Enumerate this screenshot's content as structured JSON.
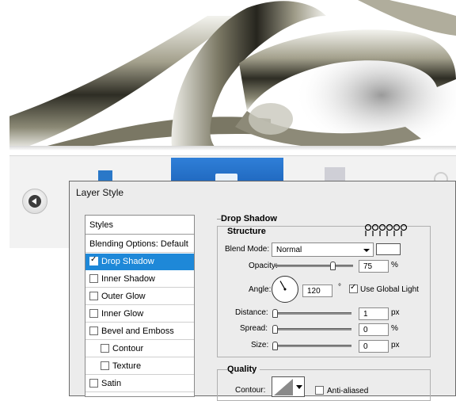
{
  "dialog": {
    "title": "Layer Style"
  },
  "styles_panel": {
    "header": "Styles",
    "blending_options": "Blending Options: Default",
    "items": [
      {
        "label": "Drop Shadow",
        "checked": true,
        "selected": true,
        "indent": false
      },
      {
        "label": "Inner Shadow",
        "checked": false,
        "selected": false,
        "indent": false
      },
      {
        "label": "Outer Glow",
        "checked": false,
        "selected": false,
        "indent": false
      },
      {
        "label": "Inner Glow",
        "checked": false,
        "selected": false,
        "indent": false
      },
      {
        "label": "Bevel and Emboss",
        "checked": false,
        "selected": false,
        "indent": false
      },
      {
        "label": "Contour",
        "checked": false,
        "selected": false,
        "indent": true
      },
      {
        "label": "Texture",
        "checked": false,
        "selected": false,
        "indent": true
      },
      {
        "label": "Satin",
        "checked": false,
        "selected": false,
        "indent": false
      }
    ]
  },
  "drop_shadow": {
    "title": "Drop Shadow",
    "structure": {
      "title": "Structure",
      "blend_mode_label": "Blend Mode:",
      "blend_mode_value": "Normal",
      "shadow_color": "#ffffff",
      "opacity_label": "Opacity:",
      "opacity_value": "75",
      "opacity_unit": "%",
      "opacity_fraction": 0.75,
      "angle_label": "Angle:",
      "angle_value": "120",
      "angle_unit": "°",
      "use_global_light_label": "Use Global Light",
      "use_global_light": true,
      "distance_label": "Distance:",
      "distance_value": "1",
      "distance_unit": "px",
      "spread_label": "Spread:",
      "spread_value": "0",
      "spread_unit": "%",
      "size_label": "Size:",
      "size_value": "0",
      "size_unit": "px"
    },
    "quality": {
      "title": "Quality",
      "contour_label": "Contour:",
      "anti_aliased_label": "Anti-aliased",
      "anti_aliased": false
    }
  },
  "colors": {
    "selection": "#1e88d8",
    "gallery_selected": "#2f7fd8"
  }
}
